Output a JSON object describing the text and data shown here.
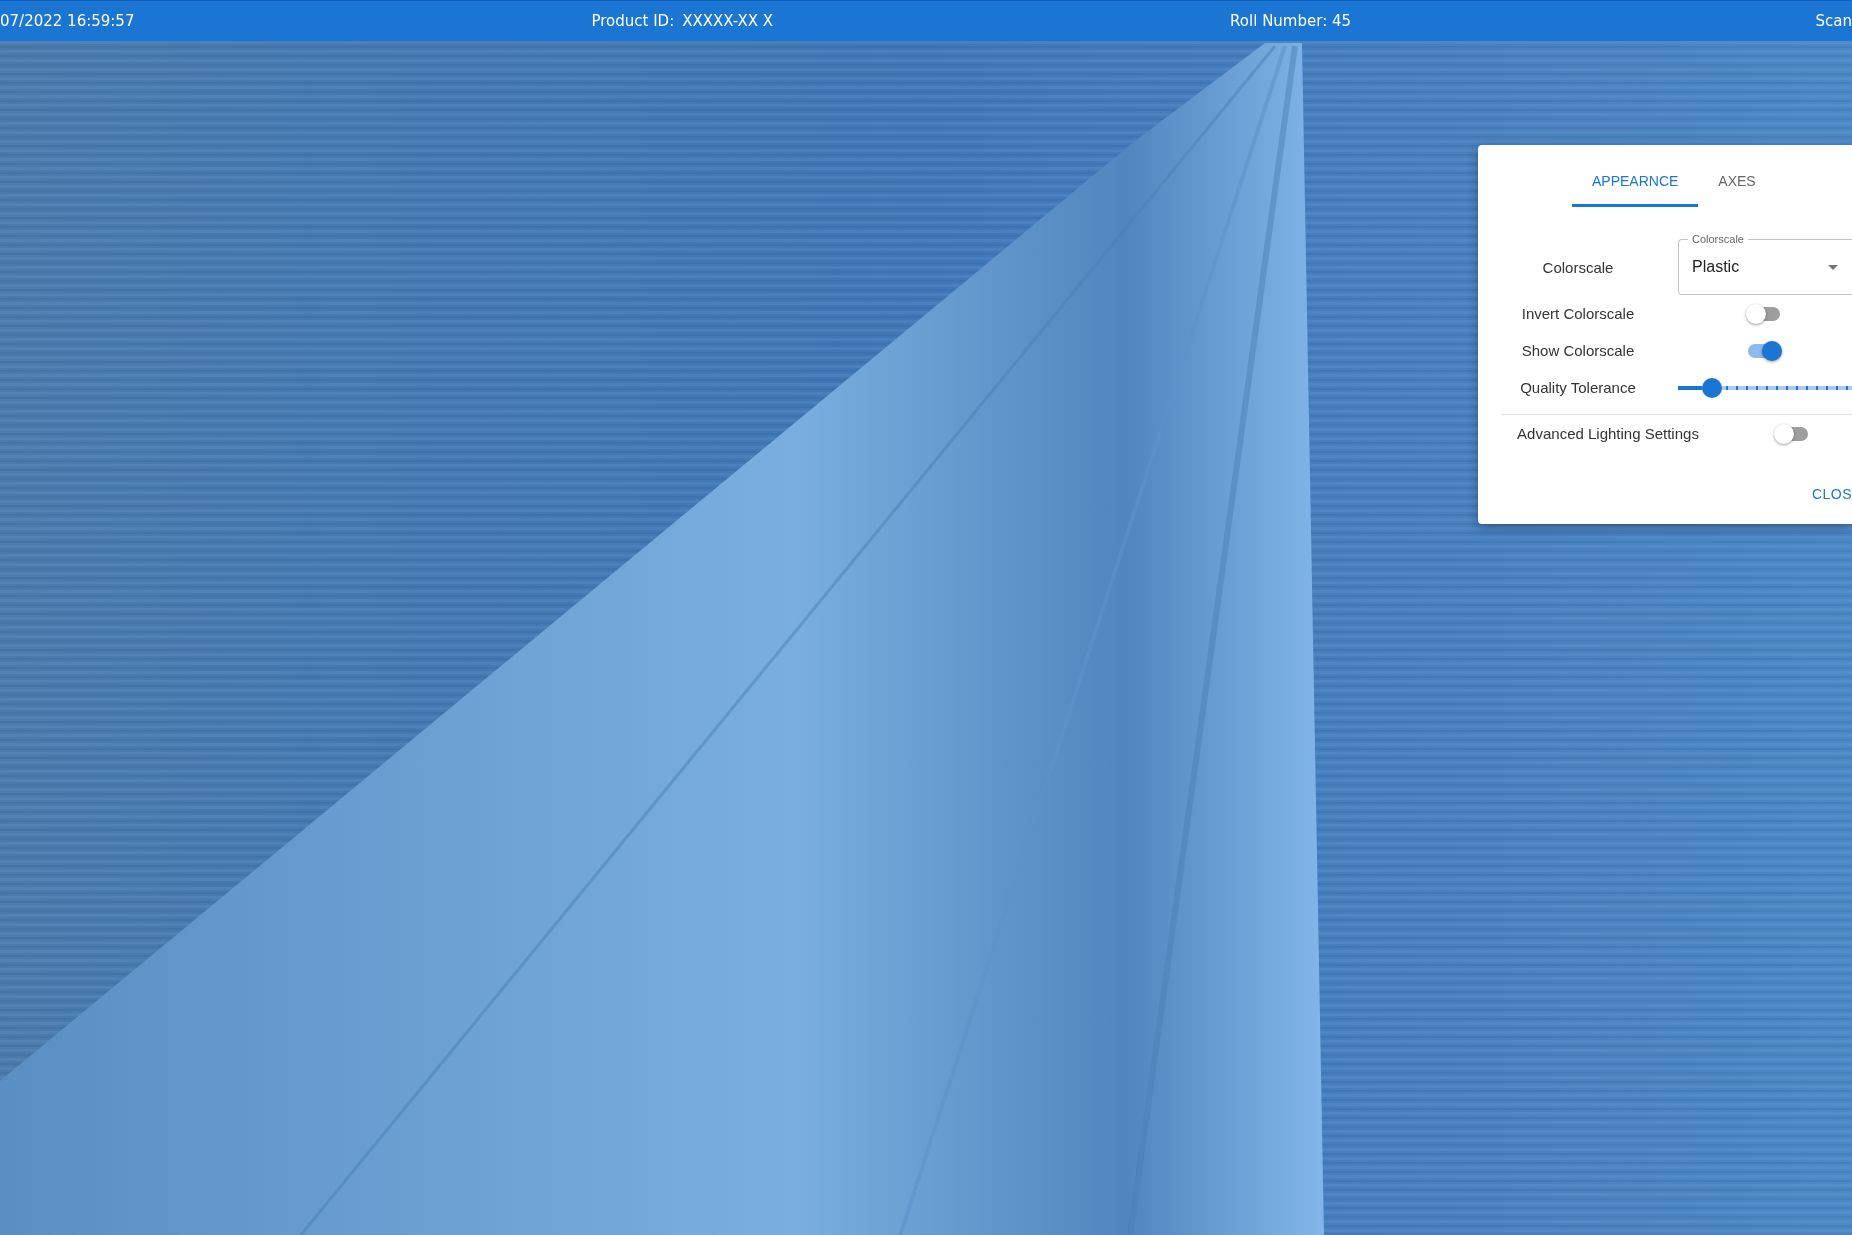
{
  "top_bar": {
    "datetime": "07/2022 16:59:57",
    "product_id_label": "Product ID:",
    "product_id": "XXXXX-XX X",
    "roll_number": "Roll Number: 45",
    "scan": "Scan"
  },
  "settings_panel": {
    "tabs": [
      {
        "label": "APPEARNCE",
        "selected": true
      },
      {
        "label": "AXES",
        "selected": false
      }
    ],
    "colorscale_label": "Colorscale",
    "colorscale_select": {
      "label": "Colorscale",
      "value": "Plastic"
    },
    "rows": [
      {
        "kind": "toggle",
        "label": "Invert Colorscale",
        "on": false
      },
      {
        "kind": "toggle",
        "label": "Show Colorscale",
        "on": true
      },
      {
        "kind": "slider",
        "label": "Quality Tolerance",
        "level": 0.14
      },
      {
        "kind": "divider"
      },
      {
        "kind": "toggle",
        "label": "Advanced Lighting Settings",
        "on": false
      }
    ],
    "close_button": "CLOS"
  }
}
